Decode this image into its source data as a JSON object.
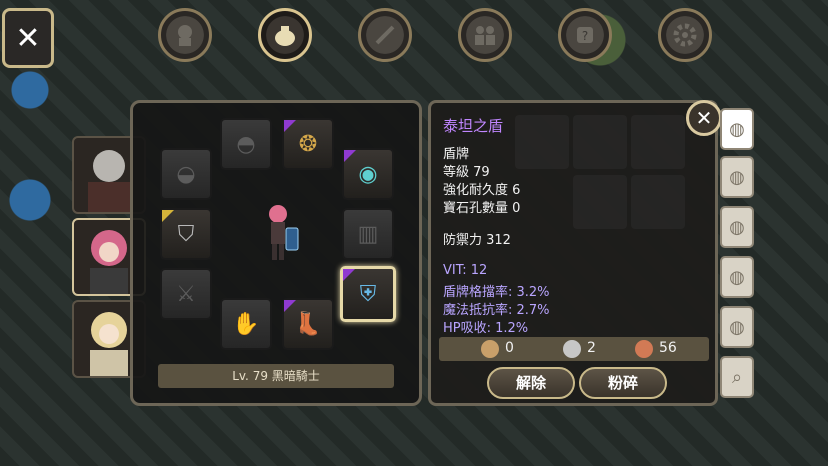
{
  "nav": {
    "close_label": "✕",
    "tabs": [
      {
        "name": "character-tab",
        "icon": "head-icon"
      },
      {
        "name": "bag-tab",
        "icon": "pouch-icon"
      },
      {
        "name": "skill-tab",
        "icon": "sword-icon"
      },
      {
        "name": "party-tab",
        "icon": "people-icon"
      },
      {
        "name": "quest-tab",
        "icon": "scroll-icon"
      },
      {
        "name": "settings-tab",
        "icon": "gear-icon"
      }
    ]
  },
  "equipment": {
    "level_label": "Lv. 79 黑暗騎士"
  },
  "item": {
    "name": "泰坦之盾",
    "type": "盾牌",
    "level": "等級 79",
    "durability": "強化耐久度 6",
    "sockets": "寶石孔數量 0",
    "defense": "防禦力 312",
    "stats": [
      "VIT: 12",
      "盾牌格擋率: 3.2%",
      "魔法抵抗率: 2.7%",
      "HP吸收: 1.2%"
    ]
  },
  "currency": [
    {
      "name": "gold",
      "value": "0",
      "color": "#c9a06a"
    },
    {
      "name": "silver",
      "value": "2",
      "color": "#c7c7c7"
    },
    {
      "name": "copper",
      "value": "56",
      "color": "#d27a55"
    }
  ],
  "buttons": {
    "unequip": "解除",
    "smash": "粉碎"
  },
  "colors": {
    "accent": "#d9c48f",
    "rare_purple": "#8f3ad0",
    "item_name": "#c086ff",
    "stat_text": "#b9a5ff"
  }
}
